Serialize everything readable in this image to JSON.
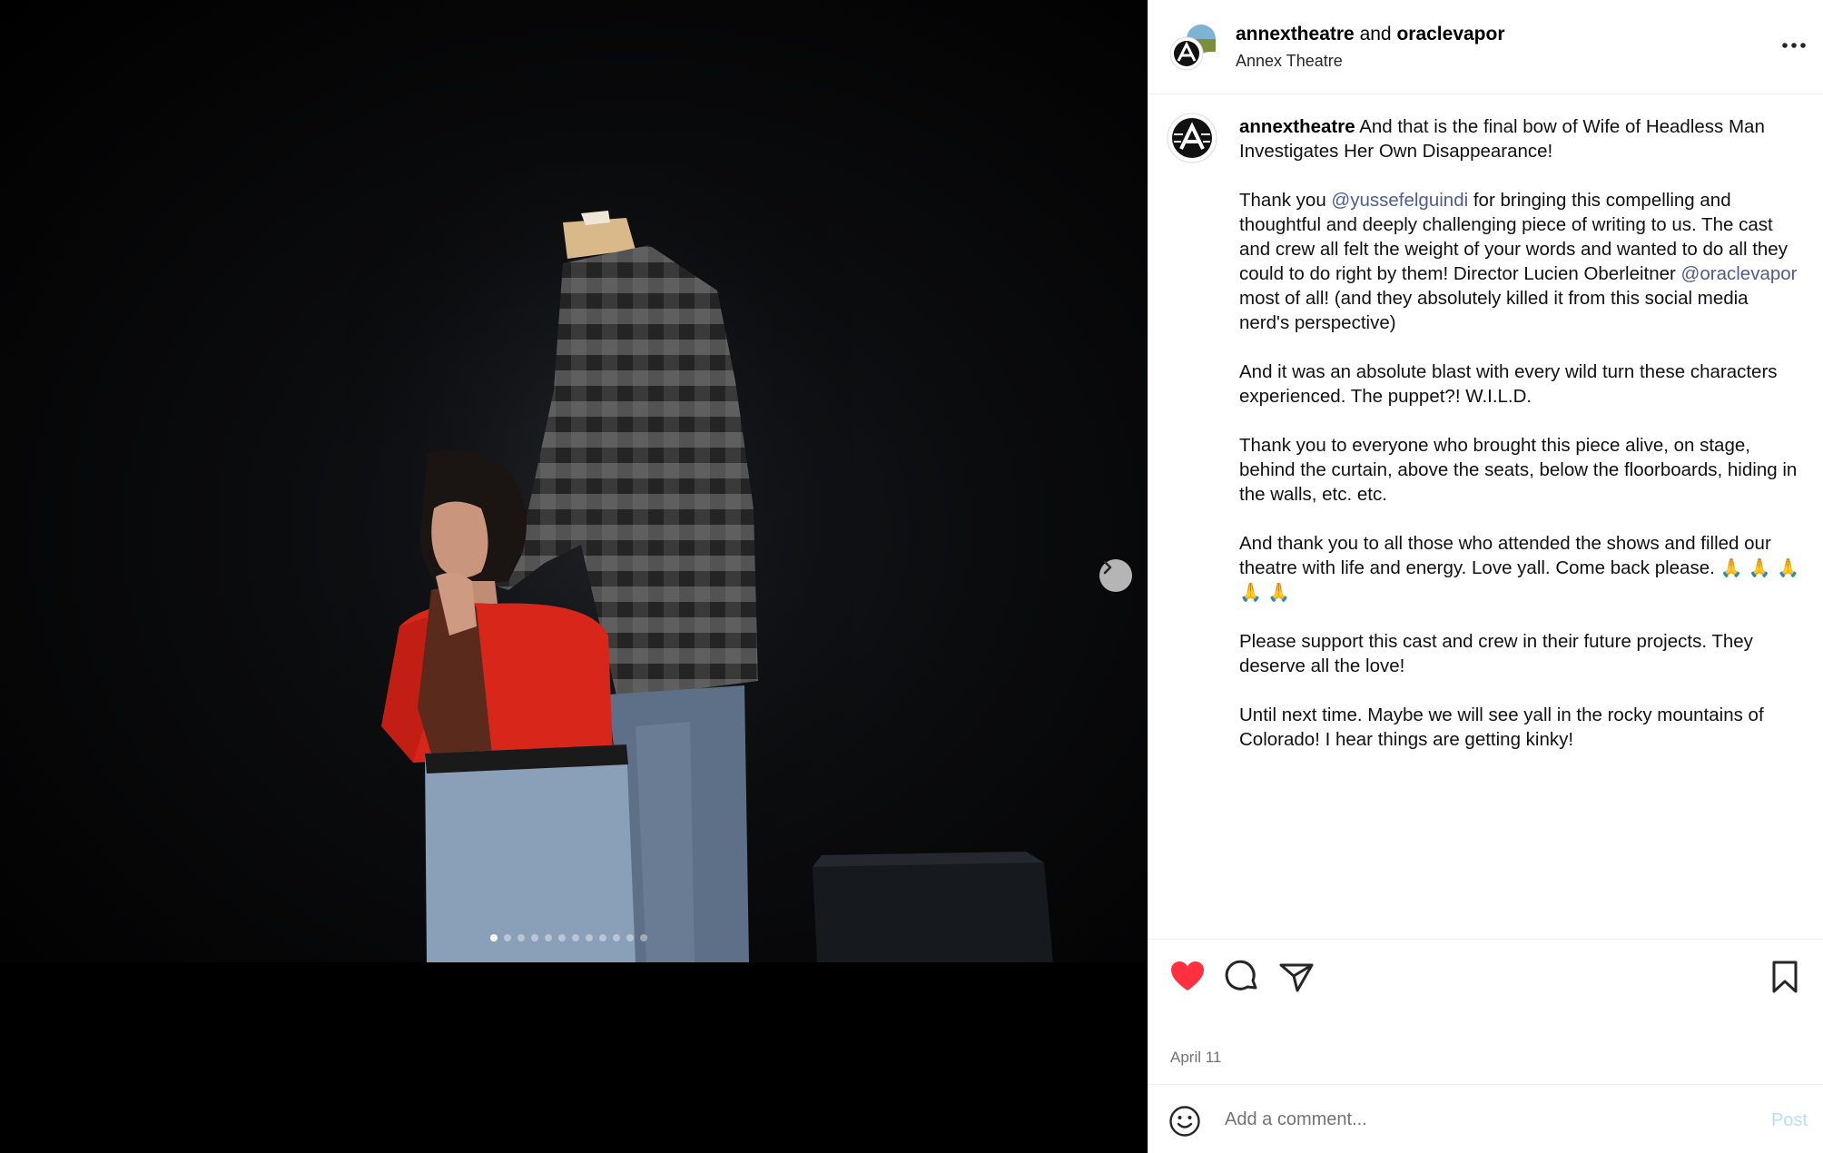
{
  "colors": {
    "like_red": "#ff3040",
    "mention_blue": "#4f5b93",
    "post_disabled": "#b2dffc"
  },
  "media": {
    "carousel_total": 12,
    "carousel_active_index": 0,
    "next_icon": "chevron-right-icon"
  },
  "header": {
    "user1": "annextheatre",
    "joiner": "and",
    "user2": "oraclevapor",
    "location": "Annex Theatre",
    "more_icon": "more-horizontal-icon"
  },
  "caption": {
    "username": "annextheatre",
    "p1": "And that is the final bow of Wife of Headless Man Investigates Her Own Disappearance!",
    "p2a": "Thank you ",
    "p2_mention1": "@yussefelguindi",
    "p2b": " for bringing this compelling and thoughtful and deeply challenging piece of writing to us. The cast and crew all felt the weight of your words and wanted to do all they could to do right by them! Director Lucien Oberleitner ",
    "p2_mention2": "@oraclevapor",
    "p2c": " most of all! (and they absolutely killed it from this social media nerd's perspective)",
    "p3": "And it was an absolute blast with every wild turn these characters experienced. The puppet?! W.I.L.D.",
    "p4": "Thank you to everyone who brought this piece alive, on stage, behind the curtain, above the seats, below the floorboards, hiding in the walls, etc. etc.",
    "p5": "And thank you to all those who attended the shows and filled our theatre with life and energy. Love yall. Come back please.",
    "p5_emoji": "🙏 🙏 🙏 🙏 🙏",
    "p6": "Please support this cast and crew in their future projects. They deserve all the love!",
    "p7": "Until next time. Maybe we will see yall in the rocky mountains of Colorado! I hear things are getting kinky!"
  },
  "actions": {
    "like_icon": "heart-filled-icon",
    "comment_icon": "comment-icon",
    "share_icon": "share-icon",
    "save_icon": "bookmark-icon",
    "date": "April 11"
  },
  "comment": {
    "emoji_icon": "smiley-icon",
    "placeholder": "Add a comment...",
    "post_label": "Post"
  }
}
